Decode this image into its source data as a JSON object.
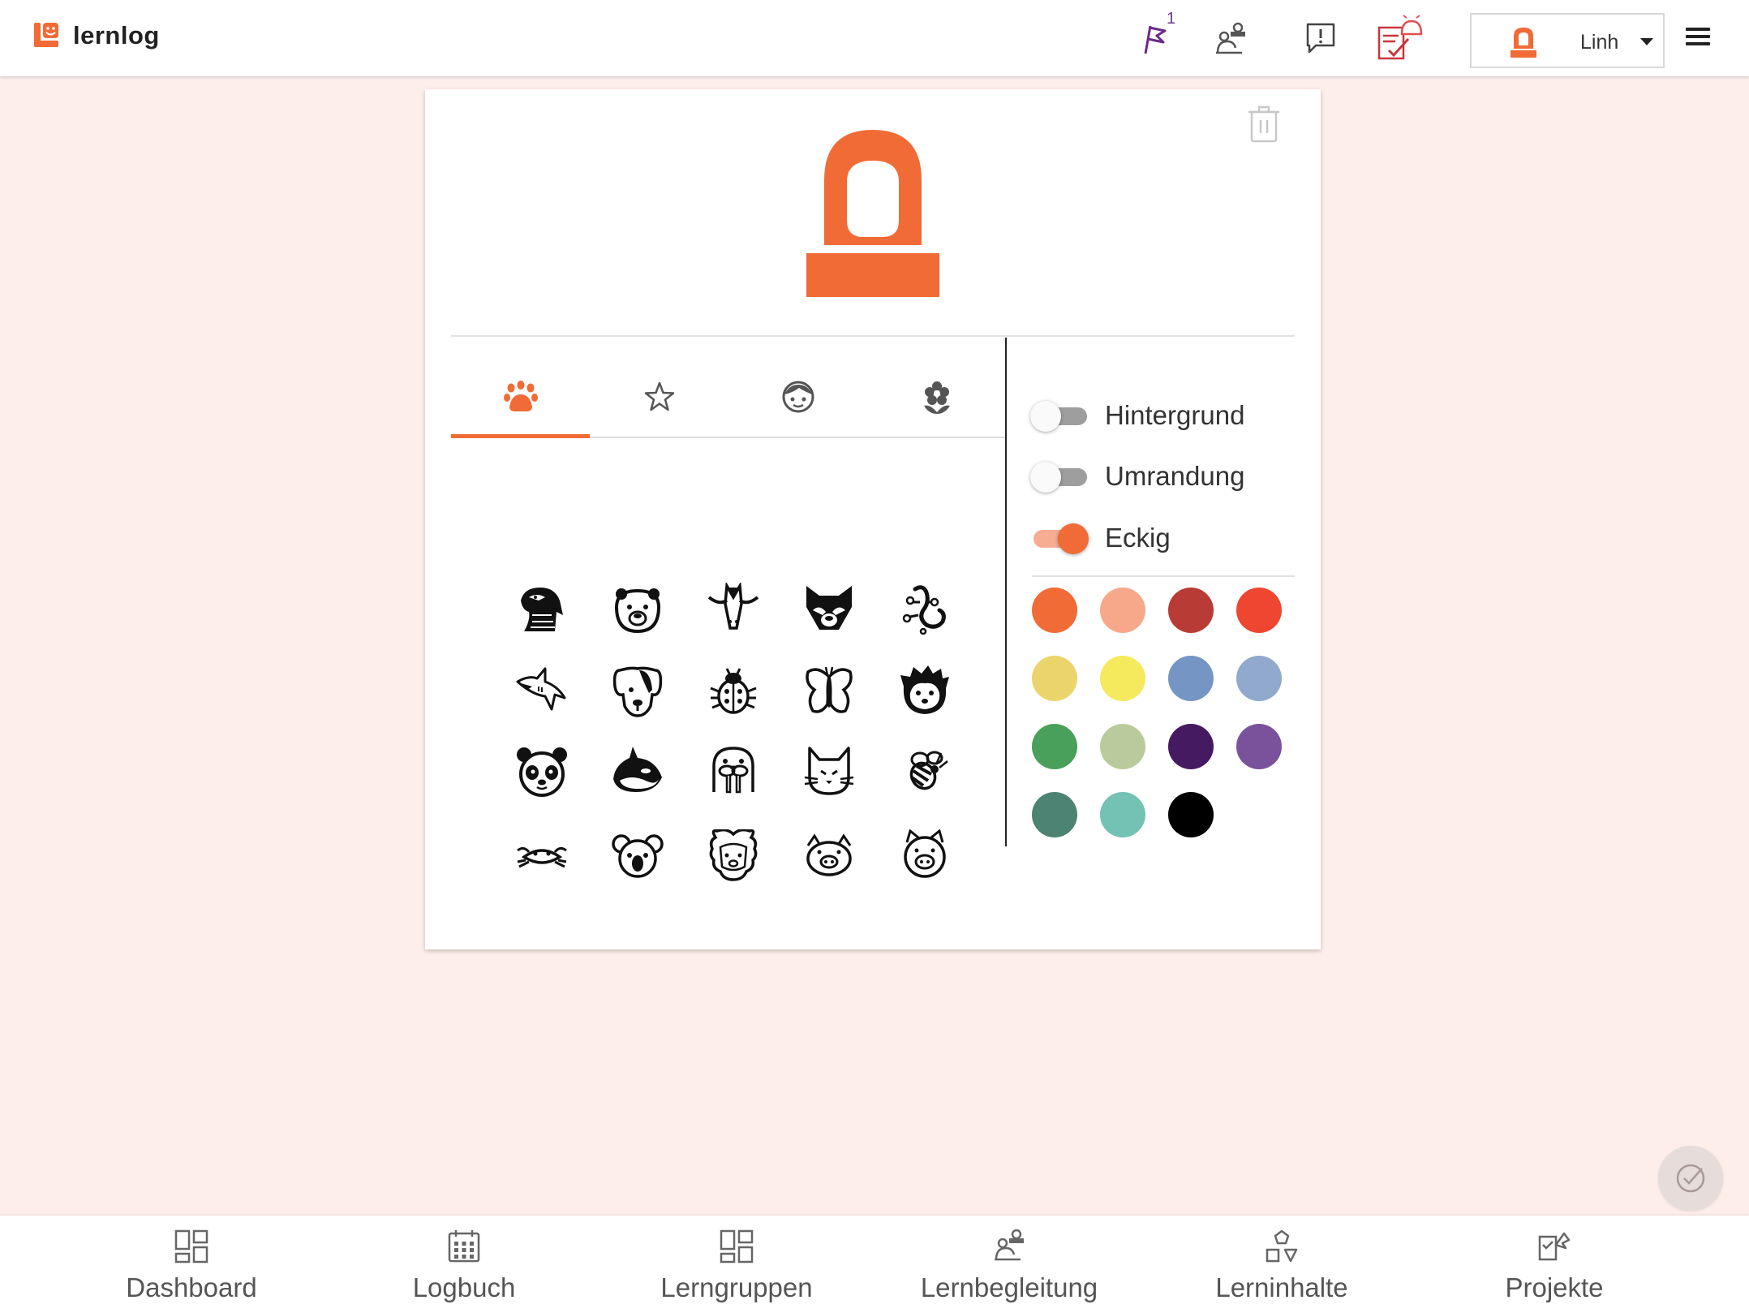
{
  "app": {
    "name": "lernlog",
    "brand_color": "#f06b36"
  },
  "header": {
    "icons": [
      "flag-icon",
      "coaching-icon",
      "feedback-icon",
      "tasks-alert-icon"
    ],
    "flag_count": "1",
    "user": {
      "name": "Linh",
      "avatar_icon": "stamp-icon"
    },
    "menu_icon": "hamburger-icon"
  },
  "editor": {
    "preview_icon": "stamp-icon",
    "delete_icon": "trash-icon",
    "tabs": [
      {
        "name": "animals",
        "icon": "paw-icon",
        "active": true
      },
      {
        "name": "favorites",
        "icon": "star-icon",
        "active": false
      },
      {
        "name": "faces",
        "icon": "face-icon",
        "active": false
      },
      {
        "name": "plants",
        "icon": "flower-icon",
        "active": false
      }
    ],
    "animals": [
      "eagle",
      "bear",
      "bull",
      "fox",
      "gecko",
      "shark",
      "dog",
      "ladybug",
      "butterfly",
      "hedgehog",
      "panda",
      "orca",
      "walrus",
      "cat",
      "bee",
      "crab",
      "koala",
      "sheep",
      "pig",
      "pig-face"
    ],
    "toggles": [
      {
        "label": "Hintergrund",
        "on": false
      },
      {
        "label": "Umrandung",
        "on": false
      },
      {
        "label": "Eckig",
        "on": true
      }
    ],
    "colors": [
      "#f06b36",
      "#f7a88a",
      "#b93b35",
      "#ee4630",
      "#ecd46c",
      "#f5ea5e",
      "#7595c4",
      "#90a9cc",
      "#48a05a",
      "#b9cb9c",
      "#451a61",
      "#7a529c",
      "#4d8372",
      "#73c2b4",
      "#000000"
    ]
  },
  "fab_icon": "check-circle-icon",
  "bottom_nav": [
    {
      "label": "Dashboard",
      "icon": "dashboard-icon"
    },
    {
      "label": "Logbuch",
      "icon": "calendar-icon"
    },
    {
      "label": "Lerngruppen",
      "icon": "groups-icon"
    },
    {
      "label": "Lernbegleitung",
      "icon": "coaching-icon"
    },
    {
      "label": "Lerninhalte",
      "icon": "shapes-icon"
    },
    {
      "label": "Projekte",
      "icon": "projects-icon"
    }
  ]
}
